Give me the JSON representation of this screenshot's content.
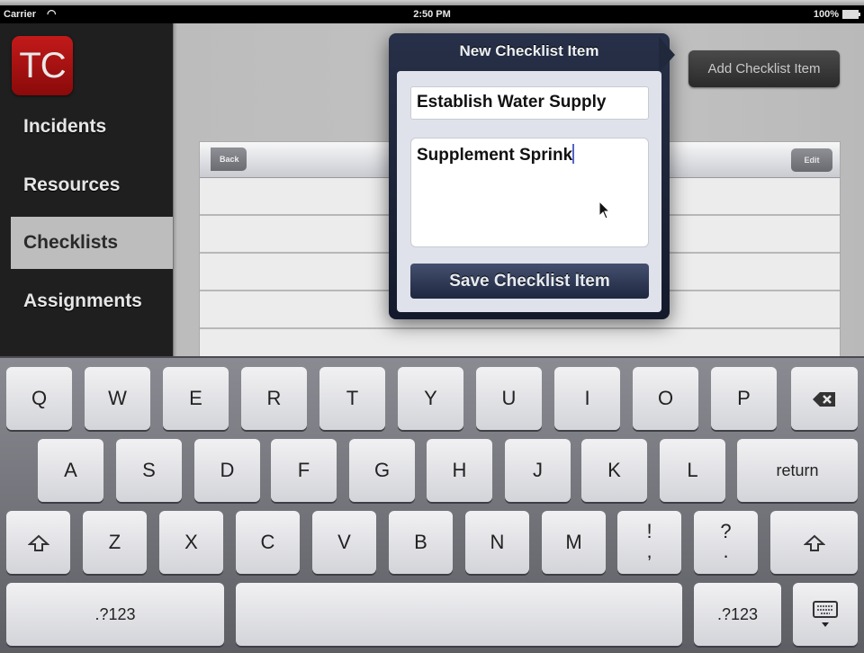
{
  "status_bar": {
    "carrier": "Carrier",
    "wifi_icon": "wifi-icon",
    "time": "2:50 PM",
    "battery": "100%",
    "battery_icon": "battery-icon"
  },
  "sidebar": {
    "logo": "TC",
    "items": [
      {
        "label": "Incidents",
        "active": false
      },
      {
        "label": "Resources",
        "active": false
      },
      {
        "label": "Checklists",
        "active": true
      },
      {
        "label": "Assignments",
        "active": false
      }
    ]
  },
  "main": {
    "add_button": "Add Checklist Item",
    "list": {
      "back_button": "Back",
      "edit_button": "Edit",
      "rows": [
        "",
        "",
        "",
        "",
        ""
      ]
    }
  },
  "popover": {
    "title": "New Checklist Item",
    "title_field_value": "Establish Water Supply",
    "description_field_value": "Supplement Sprink",
    "save_button": "Save Checklist Item"
  },
  "keyboard": {
    "row1": [
      "Q",
      "W",
      "E",
      "R",
      "T",
      "Y",
      "U",
      "I",
      "O",
      "P"
    ],
    "backspace_icon": "backspace-icon",
    "row2": [
      "A",
      "S",
      "D",
      "F",
      "G",
      "H",
      "J",
      "K",
      "L"
    ],
    "return": "return",
    "shift_icon": "shift-icon",
    "row3": [
      "Z",
      "X",
      "C",
      "V",
      "B",
      "N",
      "M"
    ],
    "punct1": {
      "top": "!",
      "bottom": ","
    },
    "punct2": {
      "top": "?",
      "bottom": "."
    },
    "numbers_left": ".?123",
    "numbers_right": ".?123",
    "hide_keyboard_icon": "hide-keyboard-icon"
  }
}
